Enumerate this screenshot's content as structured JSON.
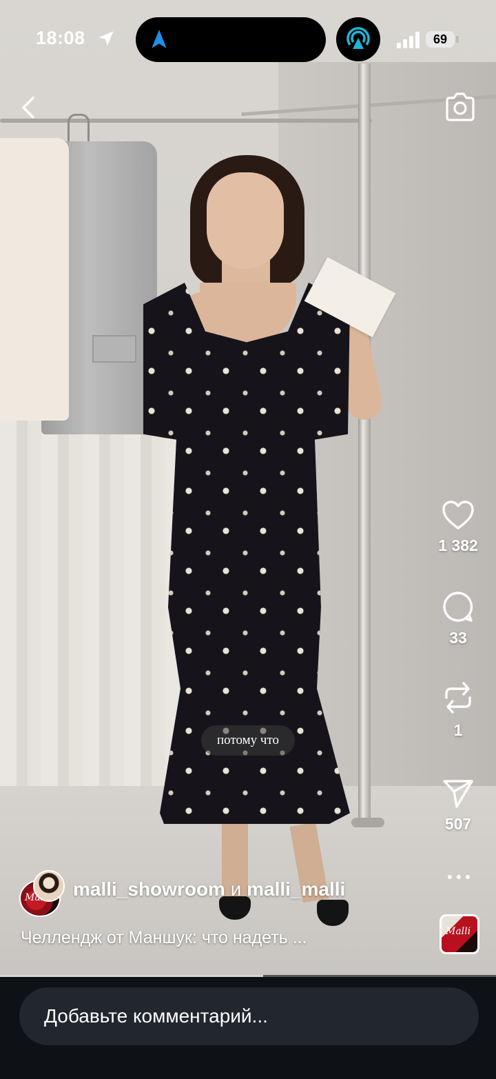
{
  "status_bar": {
    "time": "18:08",
    "battery": "69"
  },
  "video": {
    "subtitle": "потому что",
    "progress": 0.53
  },
  "actions": {
    "likes": "1 382",
    "comments": "33",
    "reposts": "1",
    "shares": "507"
  },
  "author": {
    "user1": "malli_showroom",
    "connector": " и ",
    "user2": "malli_malli",
    "avatar_text": "Malli"
  },
  "caption": "Челлендж от Маншук: что надеть ...",
  "audio": {
    "thumb_text": "Malli"
  },
  "comment": {
    "placeholder": "Добавьте комментарий..."
  },
  "icons": {
    "back": "chevron-left-icon",
    "camera": "camera-icon",
    "like": "heart-icon",
    "comment": "comment-bubble-icon",
    "repost": "repost-icon",
    "share": "paper-plane-icon",
    "more": "more-dots-icon"
  },
  "colors": {
    "bottom_bar": "#0e1116",
    "input_bg": "#22262d",
    "island_accent": "#1f8fe8",
    "hotspot_accent": "#1fb6d6"
  }
}
